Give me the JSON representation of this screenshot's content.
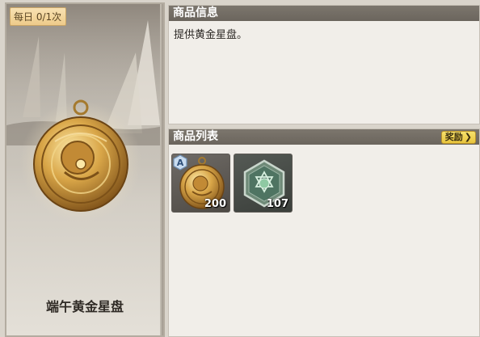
{
  "product_card": {
    "daily_limit": "每日 0/1次",
    "title": "端午黄金星盘",
    "icon": "golden-astrolabe-icon"
  },
  "info_panel": {
    "header": "商品信息",
    "description": "提供黄金星盘。"
  },
  "list_panel": {
    "header": "商品列表",
    "reward_button_label": "奖励",
    "reward_button_arrow": "❯",
    "items": [
      {
        "icon": "golden-astrolabe-icon",
        "count": "200"
      },
      {
        "icon": "green-hexagon-seal-icon",
        "count": "107"
      }
    ]
  },
  "colors": {
    "header_bg": "#6b655d",
    "panel_bg": "#f1eee9",
    "reward_button": "#e9c43c",
    "badge_bg": "#eecb8a"
  }
}
